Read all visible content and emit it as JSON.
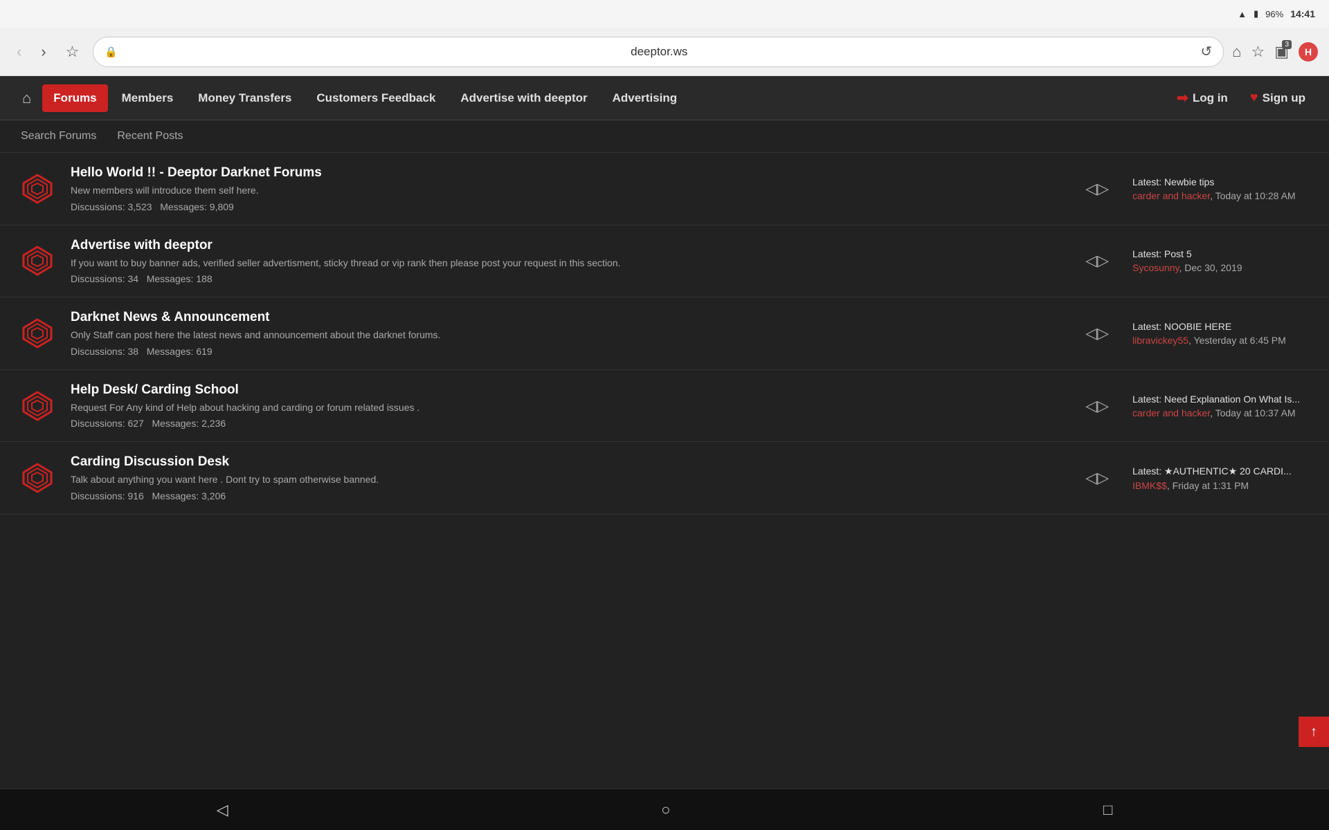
{
  "statusBar": {
    "battery": "96%",
    "time": "14:41"
  },
  "browserChrome": {
    "backBtn": "‹",
    "forwardBtn": "›",
    "url": "deeptor.ws",
    "tabCount": "3",
    "avatarLetter": "H"
  },
  "siteNav": {
    "homeIcon": "⌂",
    "items": [
      {
        "label": "Forums",
        "active": true
      },
      {
        "label": "Members",
        "active": false
      },
      {
        "label": "Money Transfers",
        "active": false
      },
      {
        "label": "Customers Feedback",
        "active": false
      },
      {
        "label": "Advertise with deeptor",
        "active": false
      },
      {
        "label": "Advertising",
        "active": false
      }
    ],
    "loginLabel": "Log in",
    "signupLabel": "Sign up"
  },
  "subNav": {
    "searchForums": "Search Forums",
    "recentPosts": "Recent Posts"
  },
  "forums": [
    {
      "title": "Hello World !! - Deeptor Darknet Forums",
      "desc": "New members will introduce them self here.",
      "discussions": "3,523",
      "messages": "9,809",
      "latestPost": "Newbie tips",
      "latestAuthor": "carder and hacker",
      "latestTime": "Today at 10:28 AM"
    },
    {
      "title": "Advertise with deeptor",
      "desc": "If you want to buy banner ads, verified seller advertisment, sticky thread or vip rank then please post your request in this section.",
      "discussions": "34",
      "messages": "188",
      "latestPost": "Post 5",
      "latestAuthor": "Sycosunny",
      "latestTime": "Dec 30, 2019"
    },
    {
      "title": "Darknet News & Announcement",
      "desc": "Only Staff can post here the latest news and announcement about the darknet forums.",
      "discussions": "38",
      "messages": "619",
      "latestPost": "NOOBIE HERE",
      "latestAuthor": "libravickey55",
      "latestTime": "Yesterday at 6:45 PM"
    },
    {
      "title": "Help Desk/ Carding School",
      "desc": "Request For Any kind of Help about hacking and carding or forum related issues .",
      "discussions": "627",
      "messages": "2,236",
      "latestPost": "Need Explanation On What Is...",
      "latestAuthor": "carder and hacker",
      "latestTime": "Today at 10:37 AM"
    },
    {
      "title": "Carding Discussion Desk",
      "desc": "Talk about anything you want here . Dont try to spam otherwise banned.",
      "discussions": "916",
      "messages": "3,206",
      "latestPost": "★AUTHENTIC★ 20 CARDI...",
      "latestAuthor": "IBMK$$",
      "latestTime": "Friday at 1:31 PM"
    }
  ],
  "statsLabels": {
    "discussions": "Discussions:",
    "messages": "Messages:"
  },
  "latestLabel": "Latest:",
  "androidNav": {
    "back": "◁",
    "home": "○",
    "recent": "□"
  },
  "scrollTop": "↑"
}
